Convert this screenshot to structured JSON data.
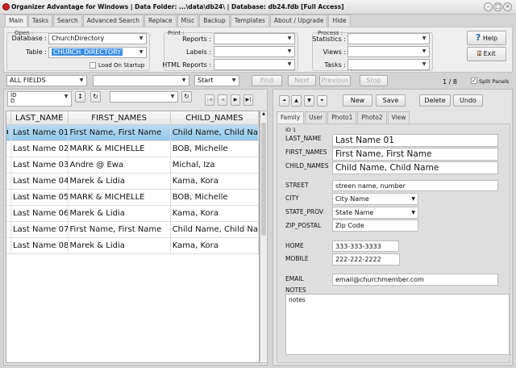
{
  "window": {
    "title": "Organizer Advantage for Windows | Data Folder: ...\\data\\db24\\ | Database: db24.fdb [Full Access]"
  },
  "tabs": [
    "Main",
    "Tasks",
    "Search",
    "Advanced Search",
    "Replace",
    "Misc",
    "Backup",
    "Templates",
    "About / Upgrade",
    "Hide"
  ],
  "open": {
    "group": "Open :",
    "database_label": "Database :",
    "database_value": "ChurchDirectory",
    "table_label": "Table :",
    "table_value": "CHURCH_DIRECTORY",
    "load_on_startup": "Load On Startup"
  },
  "print": {
    "group": "Print :",
    "reports": "Reports :",
    "labels": "Labels :",
    "html_reports": "HTML Reports :"
  },
  "process": {
    "group": "Process :",
    "statistics": "Statistics :",
    "views": "Views :",
    "tasks": "Tasks :"
  },
  "help": "Help",
  "exit": "Exit",
  "search": {
    "field": "ALL FIELDS",
    "value": "",
    "mode": "Start",
    "find": "Find",
    "next": "Next",
    "previous": "Previous",
    "stop": "Stop",
    "record_count": "1 / 8",
    "split_panels": "Split Panels"
  },
  "sort": {
    "field": "ID",
    "sub": "D"
  },
  "grid": {
    "columns": [
      "LAST_NAME",
      "FIRST_NAMES",
      "CHILD_NAMES"
    ],
    "rows": [
      [
        "Last Name 01",
        "First Name, First Name",
        "Child Name, Child Name"
      ],
      [
        "Last Name 02",
        "MARK & MICHELLE",
        "BOB, Michelle"
      ],
      [
        "Last Name 03",
        "Andre @ Ewa",
        "Michal, Iza"
      ],
      [
        "Last Name  04",
        "Marek & Lidia",
        "Kama, Kora"
      ],
      [
        "Last Name  05",
        "MARK & MICHELLE",
        "BOB, Michelle"
      ],
      [
        "Last Name  06",
        "Marek & Lidia",
        "Kama, Kora"
      ],
      [
        "Last Name  07",
        "First Name, First Name",
        "Child Name, Child Name"
      ],
      [
        "Last Name  08",
        "Marek & Lidia",
        "Kama, Kora"
      ]
    ]
  },
  "record_buttons": {
    "new": "New",
    "save": "Save",
    "delete": "Delete",
    "undo": "Undo"
  },
  "form_tabs": [
    "Family",
    "User",
    "Photo1",
    "Photo2",
    "View"
  ],
  "form": {
    "id": "ID 1",
    "last_name_label": "LAST_NAME",
    "last_name": "Last Name 01",
    "first_names_label": "FIRST_NAMES",
    "first_names": "First Name, First Name",
    "child_names_label": "CHILD_NAMES",
    "child_names": "Child Name, Child Name",
    "street_label": "STREET",
    "street": "streen name, number",
    "city_label": "CITY",
    "city": "City Name",
    "state_label": "STATE_PROV",
    "state": "State Name",
    "zip_label": "ZIP_POSTAL",
    "zip": "Zip Code",
    "home_label": "HOME",
    "home": "333-333-3333",
    "mobile_label": "MOBILE",
    "mobile": "222-222-2222",
    "email_label": "EMAIL",
    "email": "email@churchmember.com",
    "notes_label": "NOTES",
    "notes": "notes"
  }
}
